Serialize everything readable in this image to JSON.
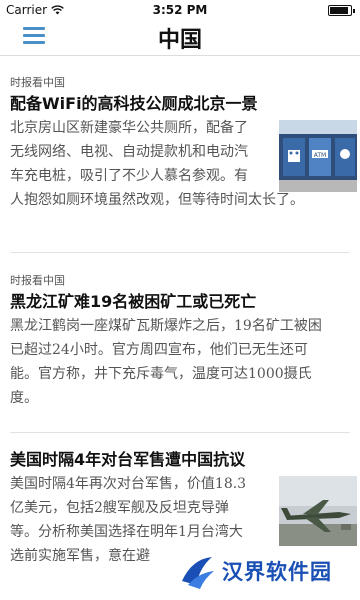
{
  "status_bar": {
    "carrier": "Carrier",
    "time": "3:52 PM",
    "battery_level": 0.9
  },
  "nav": {
    "title": "中国",
    "menu_icon": "hamburger-menu-icon"
  },
  "articles": [
    {
      "source": "时报看中国",
      "title": "配备WiFi的高科技公厕成北京一景",
      "summary_lines": [
        "北京房山区新建豪华公共厕所，配备了",
        "无线网络、电视、自动提款机和电动汽",
        "车充电桩，吸引了不少人慕名参观。有",
        "人抱怨如厕环境虽然改观，但等待时间太长了。"
      ],
      "image_labels": {
        "atm": "ATM"
      }
    },
    {
      "source": "时报看中国",
      "title": "黑龙江矿难19名被困矿工或已死亡",
      "summary_lines": [
        "黑龙江鹤岗一座煤矿瓦斯爆炸之后，19名矿工被困",
        "已超过24小时。官方周四宣布，他们已无生还可",
        "能。官方称，井下充斥毒气，温度可达1000摄氏",
        "度。"
      ]
    },
    {
      "source": "",
      "title": "美国时隔4年对台军售遭中国抗议",
      "summary_lines": [
        "美国时隔4年再次对台军售，价值18.3",
        "亿美元，包括2艘军舰及反坦克导弹",
        "等。分析称美国选择在明年1月台湾大",
        "选前实施军售，意在避"
      ]
    }
  ],
  "watermark": {
    "text": "汉界软件园",
    "logo_icon": "watermark-logo-icon"
  }
}
